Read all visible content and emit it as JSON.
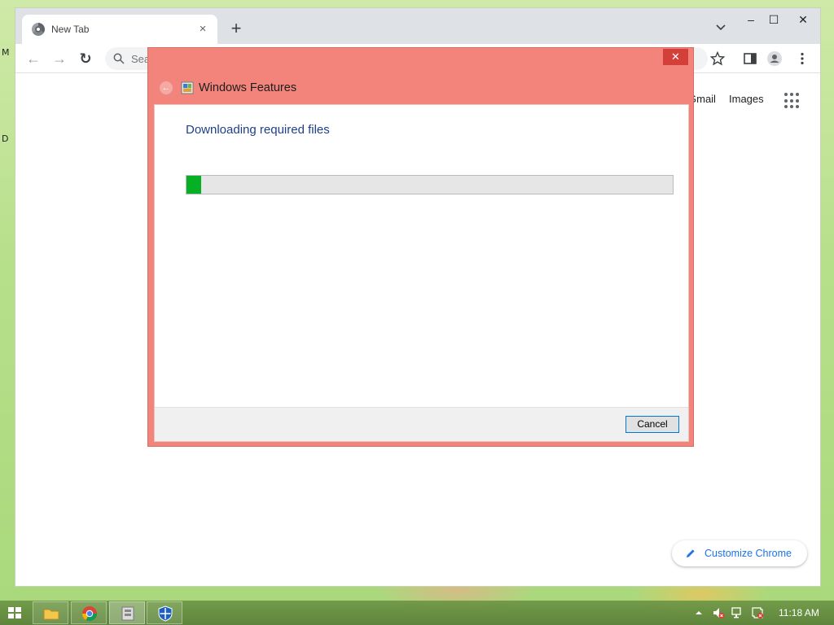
{
  "desktop": {
    "edge_letters": [
      "M",
      "D"
    ]
  },
  "browser": {
    "tab": {
      "title": "New Tab",
      "close": "×"
    },
    "new_tab": "+",
    "window_controls": {
      "minimize": "–",
      "maximize": "☐",
      "close": "✕"
    },
    "toolbar": {
      "back": "←",
      "forward": "→",
      "reload": "↻"
    },
    "omnibox": {
      "placeholder": "Search Google or type a URL"
    },
    "links": {
      "gmail": "Gmail",
      "images": "Images"
    },
    "customize_label": "Customize Chrome"
  },
  "dialog": {
    "title": "Windows Features",
    "close": "✕",
    "back": "←",
    "heading": "Downloading required files",
    "progress_percent": 3,
    "progress_color": "#06b025",
    "cancel_label": "Cancel"
  },
  "taskbar": {
    "items": [
      "file-explorer",
      "chrome",
      "windows-features",
      "defender"
    ],
    "clock": "11:18 AM"
  }
}
